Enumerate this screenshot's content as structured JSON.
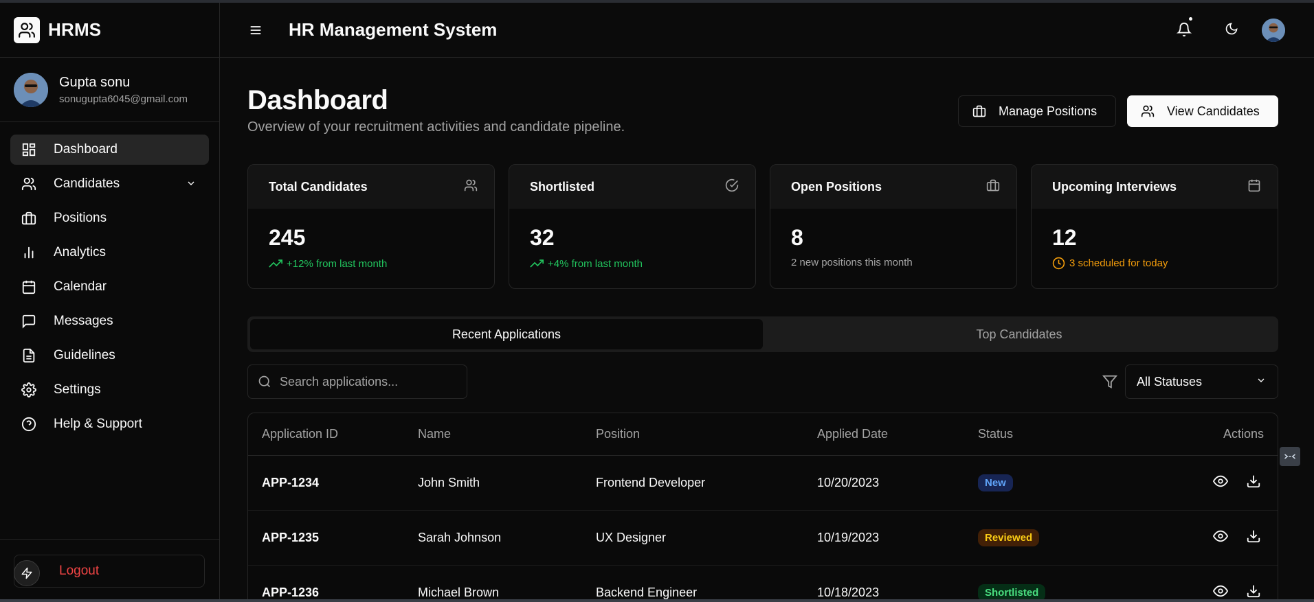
{
  "app": {
    "brand": "HRMS",
    "title": "HR Management System"
  },
  "user": {
    "name": "Gupta sonu",
    "email": "sonugupta6045@gmail.com"
  },
  "sidebar": {
    "items": [
      {
        "label": "Dashboard",
        "icon": "dashboard-icon",
        "active": true
      },
      {
        "label": "Candidates",
        "icon": "users-icon",
        "expandable": true
      },
      {
        "label": "Positions",
        "icon": "briefcase-icon"
      },
      {
        "label": "Analytics",
        "icon": "bar-chart-icon"
      },
      {
        "label": "Calendar",
        "icon": "calendar-icon"
      },
      {
        "label": "Messages",
        "icon": "message-icon"
      },
      {
        "label": "Guidelines",
        "icon": "document-icon"
      },
      {
        "label": "Settings",
        "icon": "gear-icon"
      },
      {
        "label": "Help & Support",
        "icon": "help-icon"
      }
    ],
    "logout_label": "Logout"
  },
  "page": {
    "title": "Dashboard",
    "subtitle": "Overview of your recruitment activities and candidate pipeline.",
    "manage_positions_label": "Manage Positions",
    "view_candidates_label": "View Candidates"
  },
  "stats": [
    {
      "title": "Total Candidates",
      "value": "245",
      "note": "+12% from last month",
      "icon": "users-icon",
      "tone": "green"
    },
    {
      "title": "Shortlisted",
      "value": "32",
      "note": "+4% from last month",
      "icon": "check-circle-icon",
      "tone": "green"
    },
    {
      "title": "Open Positions",
      "value": "8",
      "note": "2 new positions this month",
      "icon": "briefcase-icon",
      "tone": "muted"
    },
    {
      "title": "Upcoming Interviews",
      "value": "12",
      "note": "3 scheduled for today",
      "icon": "calendar-icon",
      "tone": "orange"
    }
  ],
  "tabs": [
    {
      "label": "Recent Applications",
      "active": true
    },
    {
      "label": "Top Candidates",
      "active": false
    }
  ],
  "search": {
    "placeholder": "Search applications..."
  },
  "filter": {
    "selected": "All Statuses"
  },
  "table": {
    "headers": [
      "Application ID",
      "Name",
      "Position",
      "Applied Date",
      "Status",
      "Actions"
    ],
    "rows": [
      {
        "id": "APP-1234",
        "name": "John Smith",
        "position": "Frontend Developer",
        "date": "10/20/2023",
        "status": "New"
      },
      {
        "id": "APP-1235",
        "name": "Sarah Johnson",
        "position": "UX Designer",
        "date": "10/19/2023",
        "status": "Reviewed"
      },
      {
        "id": "APP-1236",
        "name": "Michael Brown",
        "position": "Backend Engineer",
        "date": "10/18/2023",
        "status": "Shortlisted"
      }
    ]
  },
  "colors": {
    "accent_green": "#22c55e",
    "accent_orange": "#f59e0b",
    "logout_red": "#ef4444"
  }
}
